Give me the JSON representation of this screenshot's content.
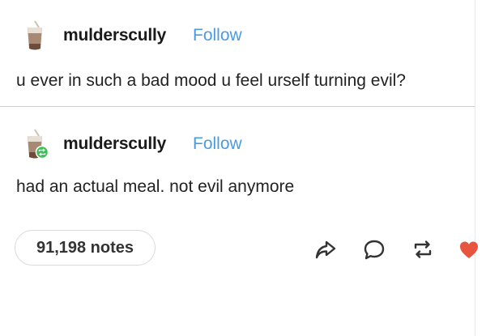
{
  "post": {
    "username": "mulderscully",
    "follow_label": "Follow",
    "text": "u ever in such a bad mood u feel urself turning evil?"
  },
  "reblog": {
    "username": "mulderscully",
    "follow_label": "Follow",
    "text": "had an actual meal. not evil anymore"
  },
  "footer": {
    "notes_label": "91,198 notes",
    "actions": [
      "share-icon",
      "reply-icon",
      "reblog-icon",
      "heart-icon"
    ]
  },
  "colors": {
    "follow": "#4a9be2",
    "like": "#e8553f",
    "reblog_badge": "#3fbf5a"
  }
}
